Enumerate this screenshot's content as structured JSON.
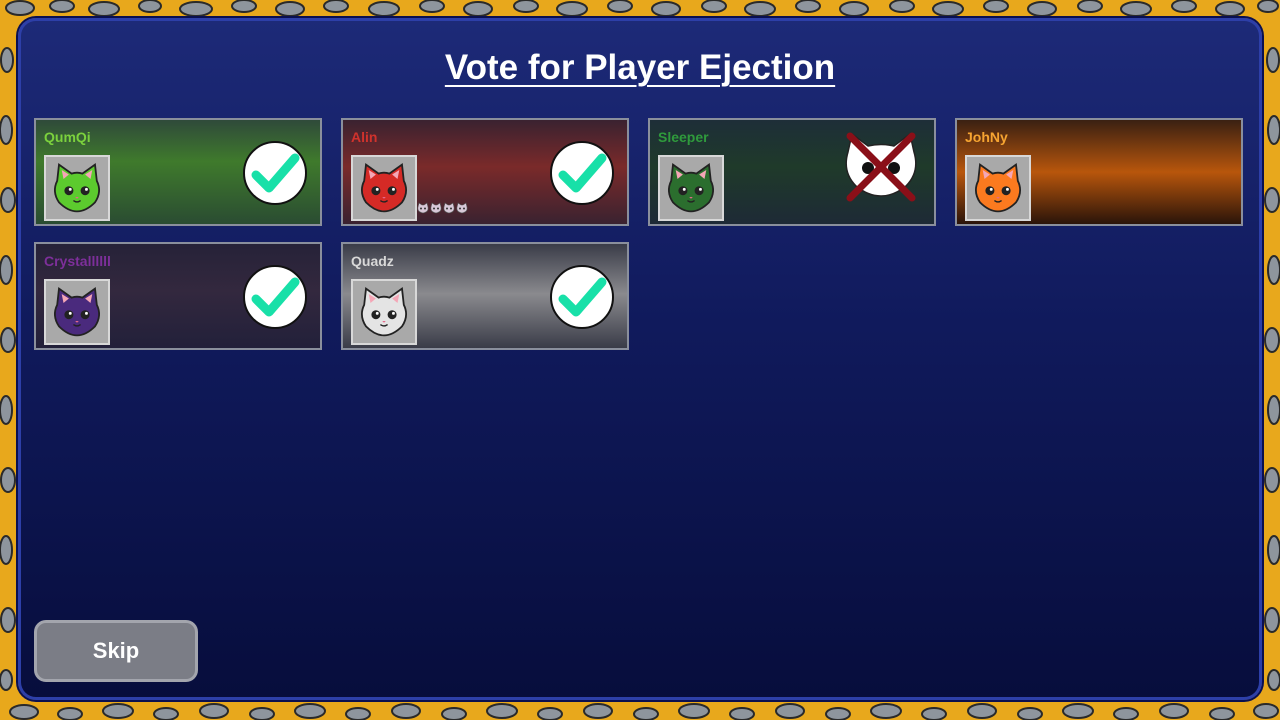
{
  "title": "Vote for Player Ejection",
  "skip_label": "Skip",
  "players": [
    {
      "name": "QumQi",
      "name_color": "#7bd13d",
      "cat_color": "#5ccb2e",
      "voted": true,
      "status": "voted"
    },
    {
      "name": "Alin",
      "name_color": "#d0322c",
      "cat_color": "#d52a26",
      "voted": true,
      "status": "voted",
      "votes_received": 4
    },
    {
      "name": "Sleeper",
      "name_color": "#2f9a3c",
      "cat_color": "#2b6e2e",
      "voted": false,
      "status": "ejected"
    },
    {
      "name": "JohNy",
      "name_color": "#f6a431",
      "cat_color": "#fb7a1f",
      "voted": false,
      "status": "not-voted"
    },
    {
      "name": "Crystallllll",
      "name_color": "#7d2f9a",
      "cat_color": "#4a2a7d",
      "voted": true,
      "status": "voted"
    },
    {
      "name": "Quadz",
      "name_color": "#d8d8d8",
      "cat_color": "#e4e4e4",
      "voted": true,
      "status": "voted"
    }
  ],
  "colors": {
    "check": "#18e0a8",
    "panel": "#101a5c",
    "border": "#e8a81c"
  }
}
